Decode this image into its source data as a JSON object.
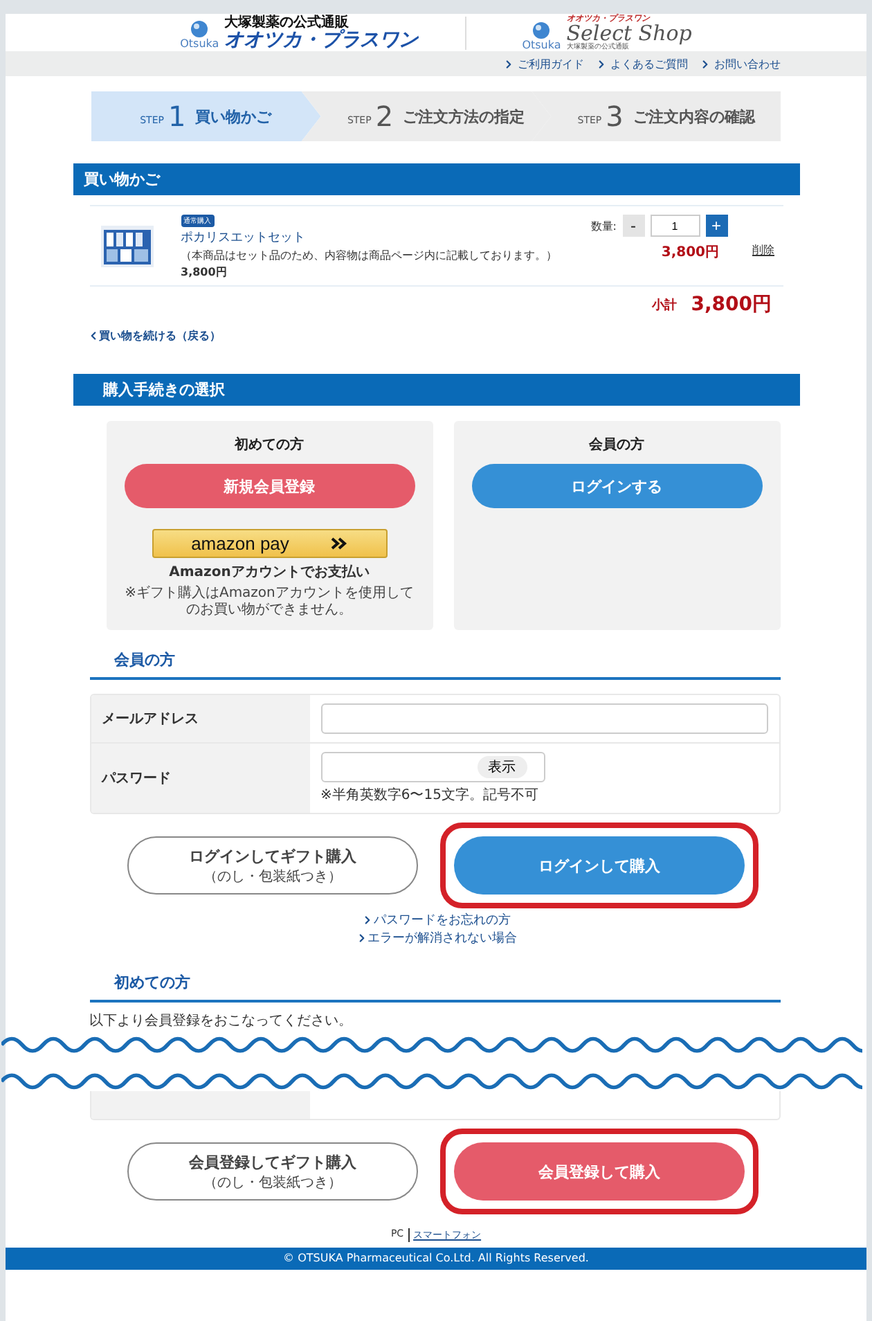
{
  "header": {
    "logos": [
      {
        "kind": "main",
        "brand": "Otsuka",
        "tagline": "大塚製薬の公式通販",
        "name": "オオツカ・プラスワン"
      },
      {
        "kind": "shop",
        "brand": "Otsuka",
        "over": "オオツカ・プラスワン",
        "name": "Select Shop",
        "under": "大塚製薬の公式通販"
      }
    ],
    "links": [
      "ご利用ガイド",
      "よくあるご質問",
      "お問い合わせ"
    ]
  },
  "steps": [
    {
      "prefix": "STEP",
      "number": "1",
      "label": "買い物かご",
      "selected": true
    },
    {
      "prefix": "STEP",
      "number": "2",
      "label": "ご注文方法の指定",
      "selected": false
    },
    {
      "prefix": "STEP",
      "number": "3",
      "label": "ご注文内容の確認",
      "selected": false
    }
  ],
  "cart": {
    "title": "買い物かご",
    "items": [
      {
        "kind": "picture",
        "badge": "通常購入",
        "name": "ポカリスエットセット",
        "note": "（本商品はセット品のため、内容物は商品ページ内に記載しております。）",
        "price": "3,800円",
        "quantity_label": "数量:",
        "minus": "-",
        "quantity": "1",
        "plus": "+",
        "line_total": "3,800円",
        "remove": "削除"
      }
    ],
    "subtotal_label": "小計",
    "subtotal": "3,800円",
    "back_link": "買い物を続ける（戻る）"
  },
  "purchase": {
    "title": "購入手続きの選択",
    "cards": [
      {
        "heading": "初めての方",
        "button": "新規会員登録",
        "kind": "register",
        "amazon": {
          "button": "amazon pay",
          "caption": "Amazonアカウントでお支払い",
          "note": "※ギフト購入はAmazonアカウントを使用してのお買い物ができません。"
        }
      },
      {
        "heading": "会員の方",
        "button": "ログインする",
        "kind": "login"
      }
    ]
  },
  "member": {
    "title": "会員の方",
    "fields": [
      {
        "label": "メールアドレス",
        "kind": "email"
      },
      {
        "label": "パスワード",
        "kind": "password",
        "toggle": "表示",
        "hint": "※半角英数字6〜15文字。記号不可"
      }
    ],
    "actions": [
      {
        "label": "ログインしてギフト購入",
        "sub": "（のし・包装紙つき）",
        "kind": "outline",
        "highlighted": false
      },
      {
        "label": "ログインして購入",
        "kind": "login",
        "highlighted": true
      }
    ],
    "links": [
      "パスワードをお忘れの方",
      "エラーが解消されない場合"
    ]
  },
  "new_customer": {
    "title": "初めての方",
    "intro": "以下より会員登録をおこなってください。",
    "actions": [
      {
        "label": "会員登録してギフト購入",
        "sub": "（のし・包装紙つき）",
        "kind": "outline",
        "highlighted": false
      },
      {
        "label": "会員登録して購入",
        "kind": "register",
        "highlighted": true
      }
    ]
  },
  "footer": {
    "views": [
      {
        "label": "PC",
        "selected": true
      },
      {
        "label": "スマートフォン",
        "selected": false
      }
    ],
    "copyright": "© OTSUKA Pharmaceutical Co.Ltd. All Rights Reserved."
  }
}
